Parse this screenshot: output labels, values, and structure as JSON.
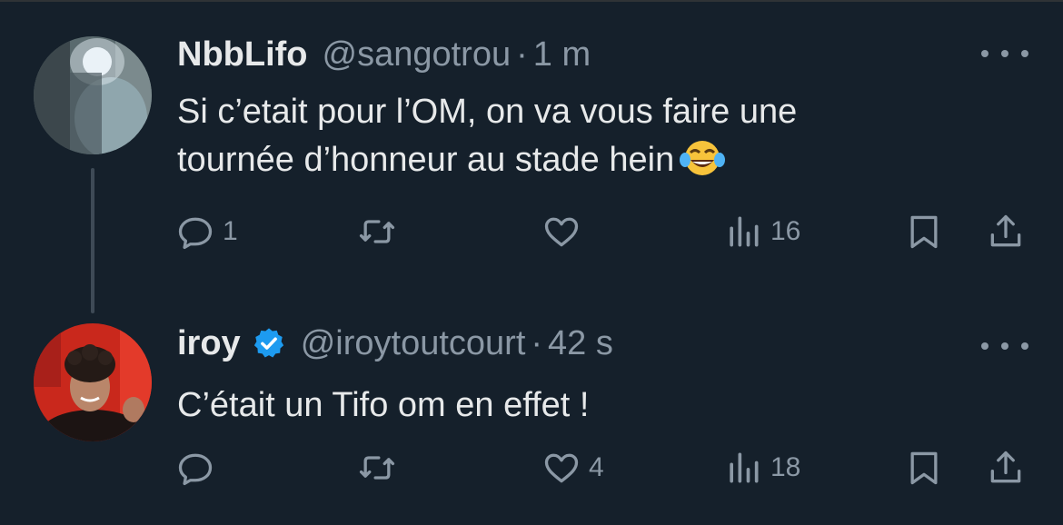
{
  "tweets": [
    {
      "name": "NbbLifo",
      "handle": "@sangotrou",
      "time": "1 m",
      "verified": false,
      "text_line1": "Si c’etait pour l’OM, on va vous faire une",
      "text_line2": "tournée d’honneur au stade hein",
      "emoji": "face-with-tears-of-joy",
      "replies": "1",
      "retweets": "",
      "likes": "",
      "views": "16"
    },
    {
      "name": "iroy",
      "handle": "@iroytoutcourt",
      "time": "42 s",
      "verified": true,
      "text_line1": "C’était un Tifo om en effet !",
      "replies": "",
      "retweets": "",
      "likes": "4",
      "views": "18"
    }
  ],
  "separator": "·",
  "colors": {
    "background": "#15202b",
    "primary_text": "#e7e9ea",
    "secondary_text": "#8b98a5",
    "verified": "#1d9bf0"
  }
}
